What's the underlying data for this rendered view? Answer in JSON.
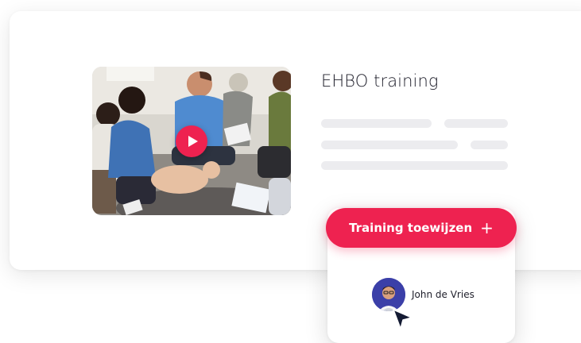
{
  "course": {
    "title": "EHBO training"
  },
  "assign": {
    "button_label": "Training toewijzen",
    "plus_glyph": "+"
  },
  "user": {
    "name": "John de Vries"
  },
  "colors": {
    "accent": "#ee2250",
    "placeholder_bar": "#ececef",
    "avatar_bg": "#3b3fa8",
    "cursor": "#141b33"
  },
  "icons": [
    "play-icon",
    "plus-icon",
    "cursor-icon"
  ]
}
